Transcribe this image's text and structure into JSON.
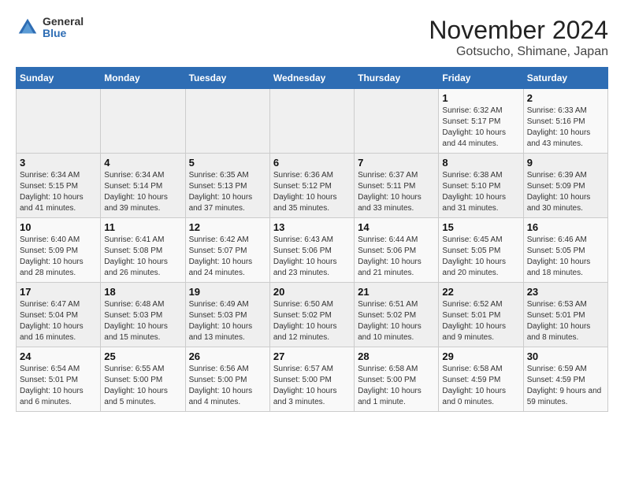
{
  "header": {
    "logo_general": "General",
    "logo_blue": "Blue",
    "title": "November 2024",
    "subtitle": "Gotsucho, Shimane, Japan"
  },
  "calendar": {
    "days_of_week": [
      "Sunday",
      "Monday",
      "Tuesday",
      "Wednesday",
      "Thursday",
      "Friday",
      "Saturday"
    ],
    "weeks": [
      [
        {
          "day": "",
          "detail": ""
        },
        {
          "day": "",
          "detail": ""
        },
        {
          "day": "",
          "detail": ""
        },
        {
          "day": "",
          "detail": ""
        },
        {
          "day": "",
          "detail": ""
        },
        {
          "day": "1",
          "detail": "Sunrise: 6:32 AM\nSunset: 5:17 PM\nDaylight: 10 hours\nand 44 minutes."
        },
        {
          "day": "2",
          "detail": "Sunrise: 6:33 AM\nSunset: 5:16 PM\nDaylight: 10 hours\nand 43 minutes."
        }
      ],
      [
        {
          "day": "3",
          "detail": "Sunrise: 6:34 AM\nSunset: 5:15 PM\nDaylight: 10 hours\nand 41 minutes."
        },
        {
          "day": "4",
          "detail": "Sunrise: 6:34 AM\nSunset: 5:14 PM\nDaylight: 10 hours\nand 39 minutes."
        },
        {
          "day": "5",
          "detail": "Sunrise: 6:35 AM\nSunset: 5:13 PM\nDaylight: 10 hours\nand 37 minutes."
        },
        {
          "day": "6",
          "detail": "Sunrise: 6:36 AM\nSunset: 5:12 PM\nDaylight: 10 hours\nand 35 minutes."
        },
        {
          "day": "7",
          "detail": "Sunrise: 6:37 AM\nSunset: 5:11 PM\nDaylight: 10 hours\nand 33 minutes."
        },
        {
          "day": "8",
          "detail": "Sunrise: 6:38 AM\nSunset: 5:10 PM\nDaylight: 10 hours\nand 31 minutes."
        },
        {
          "day": "9",
          "detail": "Sunrise: 6:39 AM\nSunset: 5:09 PM\nDaylight: 10 hours\nand 30 minutes."
        }
      ],
      [
        {
          "day": "10",
          "detail": "Sunrise: 6:40 AM\nSunset: 5:09 PM\nDaylight: 10 hours\nand 28 minutes."
        },
        {
          "day": "11",
          "detail": "Sunrise: 6:41 AM\nSunset: 5:08 PM\nDaylight: 10 hours\nand 26 minutes."
        },
        {
          "day": "12",
          "detail": "Sunrise: 6:42 AM\nSunset: 5:07 PM\nDaylight: 10 hours\nand 24 minutes."
        },
        {
          "day": "13",
          "detail": "Sunrise: 6:43 AM\nSunset: 5:06 PM\nDaylight: 10 hours\nand 23 minutes."
        },
        {
          "day": "14",
          "detail": "Sunrise: 6:44 AM\nSunset: 5:06 PM\nDaylight: 10 hours\nand 21 minutes."
        },
        {
          "day": "15",
          "detail": "Sunrise: 6:45 AM\nSunset: 5:05 PM\nDaylight: 10 hours\nand 20 minutes."
        },
        {
          "day": "16",
          "detail": "Sunrise: 6:46 AM\nSunset: 5:05 PM\nDaylight: 10 hours\nand 18 minutes."
        }
      ],
      [
        {
          "day": "17",
          "detail": "Sunrise: 6:47 AM\nSunset: 5:04 PM\nDaylight: 10 hours\nand 16 minutes."
        },
        {
          "day": "18",
          "detail": "Sunrise: 6:48 AM\nSunset: 5:03 PM\nDaylight: 10 hours\nand 15 minutes."
        },
        {
          "day": "19",
          "detail": "Sunrise: 6:49 AM\nSunset: 5:03 PM\nDaylight: 10 hours\nand 13 minutes."
        },
        {
          "day": "20",
          "detail": "Sunrise: 6:50 AM\nSunset: 5:02 PM\nDaylight: 10 hours\nand 12 minutes."
        },
        {
          "day": "21",
          "detail": "Sunrise: 6:51 AM\nSunset: 5:02 PM\nDaylight: 10 hours\nand 10 minutes."
        },
        {
          "day": "22",
          "detail": "Sunrise: 6:52 AM\nSunset: 5:01 PM\nDaylight: 10 hours\nand 9 minutes."
        },
        {
          "day": "23",
          "detail": "Sunrise: 6:53 AM\nSunset: 5:01 PM\nDaylight: 10 hours\nand 8 minutes."
        }
      ],
      [
        {
          "day": "24",
          "detail": "Sunrise: 6:54 AM\nSunset: 5:01 PM\nDaylight: 10 hours\nand 6 minutes."
        },
        {
          "day": "25",
          "detail": "Sunrise: 6:55 AM\nSunset: 5:00 PM\nDaylight: 10 hours\nand 5 minutes."
        },
        {
          "day": "26",
          "detail": "Sunrise: 6:56 AM\nSunset: 5:00 PM\nDaylight: 10 hours\nand 4 minutes."
        },
        {
          "day": "27",
          "detail": "Sunrise: 6:57 AM\nSunset: 5:00 PM\nDaylight: 10 hours\nand 3 minutes."
        },
        {
          "day": "28",
          "detail": "Sunrise: 6:58 AM\nSunset: 5:00 PM\nDaylight: 10 hours\nand 1 minute."
        },
        {
          "day": "29",
          "detail": "Sunrise: 6:58 AM\nSunset: 4:59 PM\nDaylight: 10 hours\nand 0 minutes."
        },
        {
          "day": "30",
          "detail": "Sunrise: 6:59 AM\nSunset: 4:59 PM\nDaylight: 9 hours\nand 59 minutes."
        }
      ]
    ]
  }
}
